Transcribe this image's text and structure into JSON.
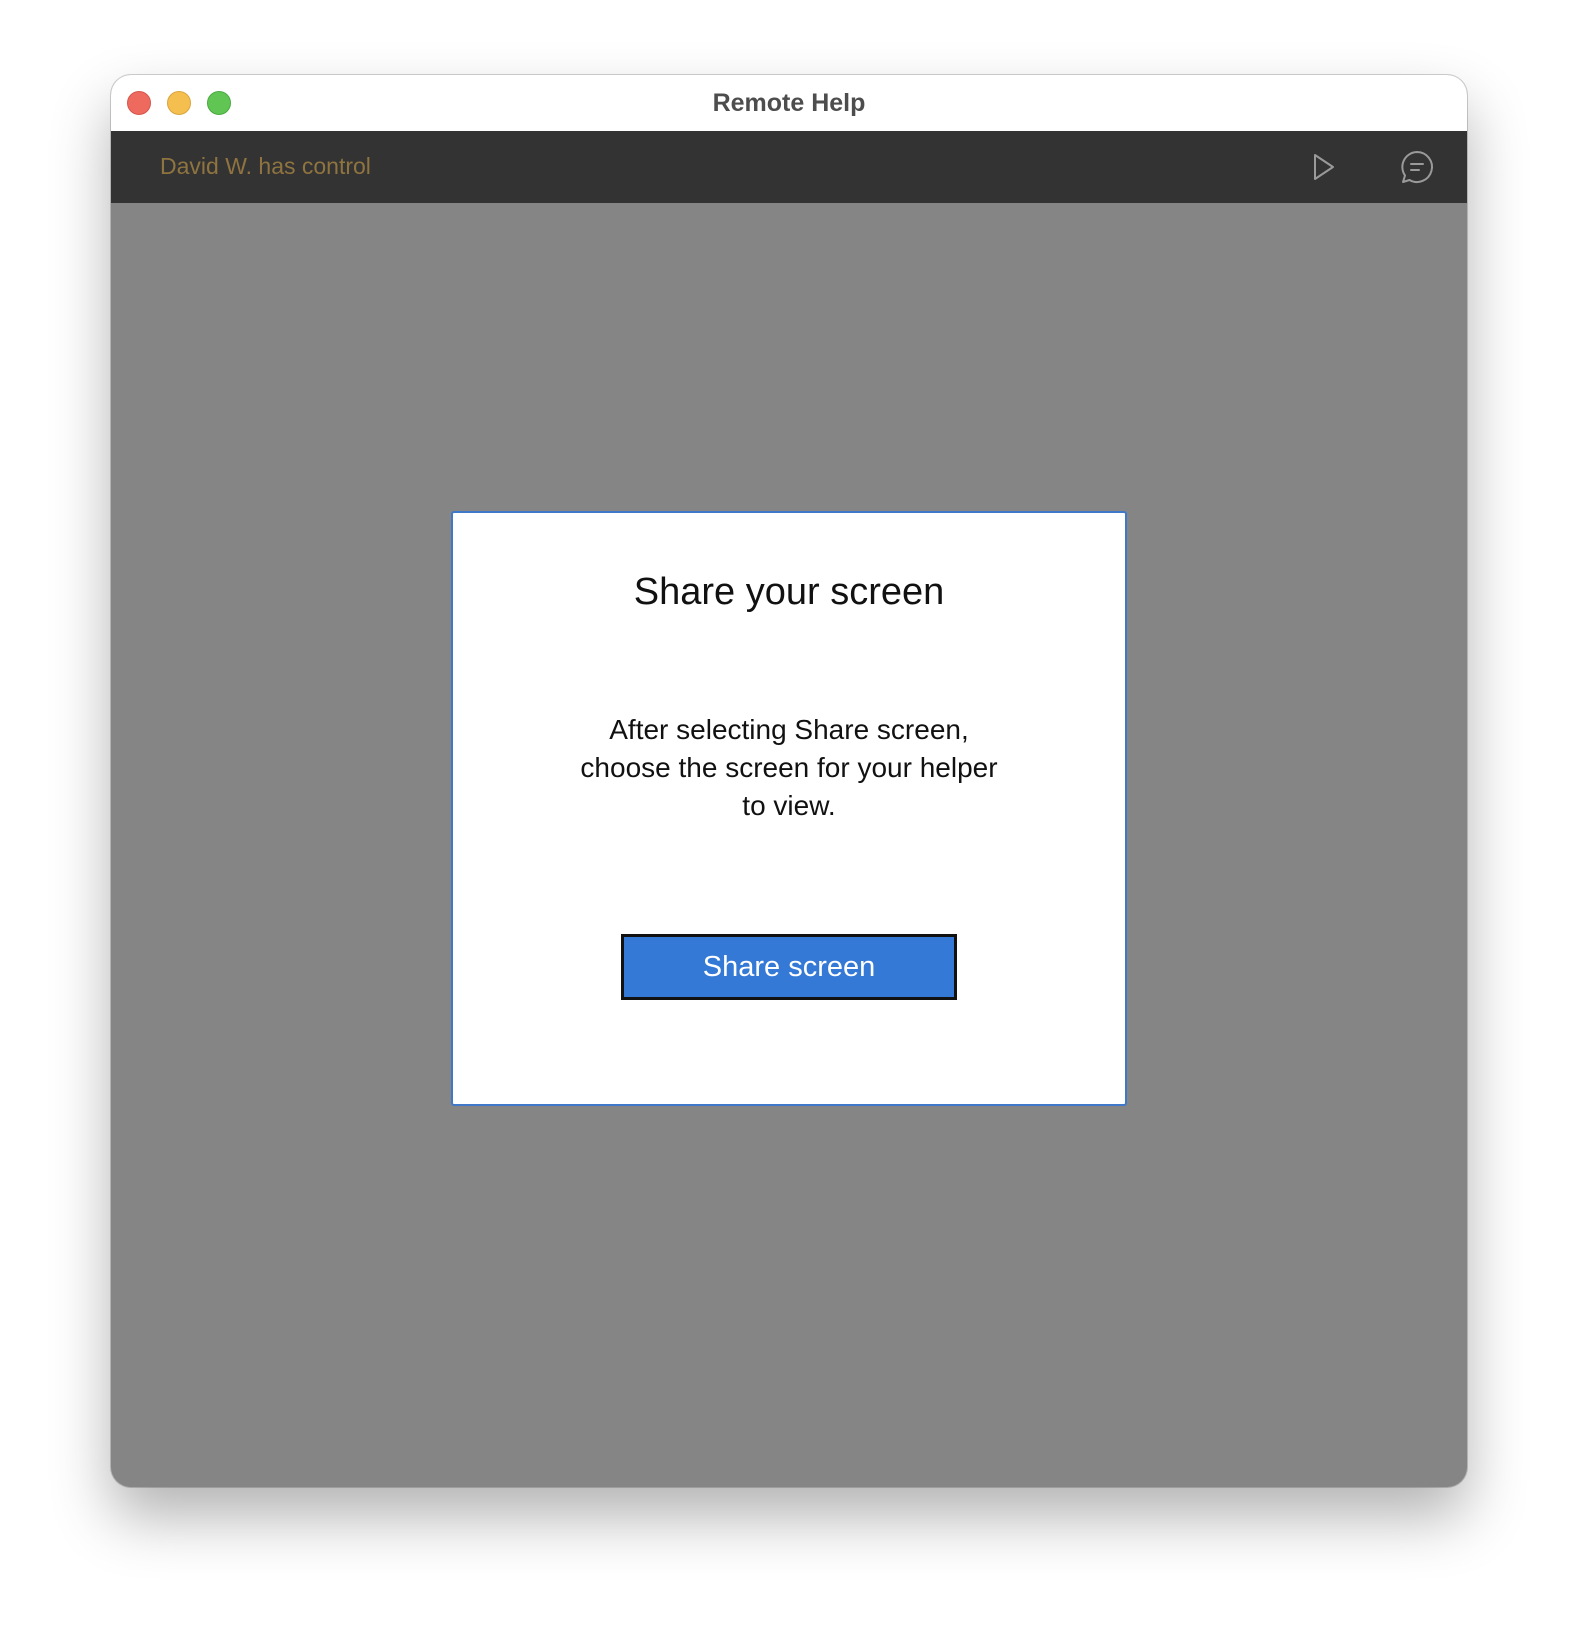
{
  "window": {
    "title": "Remote Help"
  },
  "toolbar": {
    "status_text": "David W. has control",
    "status_color": "#8f7440",
    "play_icon": "play-icon",
    "chat_icon": "chat-bubble-icon"
  },
  "dialog": {
    "title": "Share your screen",
    "body_line1": "After selecting Share screen,",
    "body_line2": "choose the screen for your helper",
    "body_line3": "to view.",
    "button_label": "Share screen",
    "button_color": "#3479d6",
    "border_color": "#3f78c9"
  }
}
